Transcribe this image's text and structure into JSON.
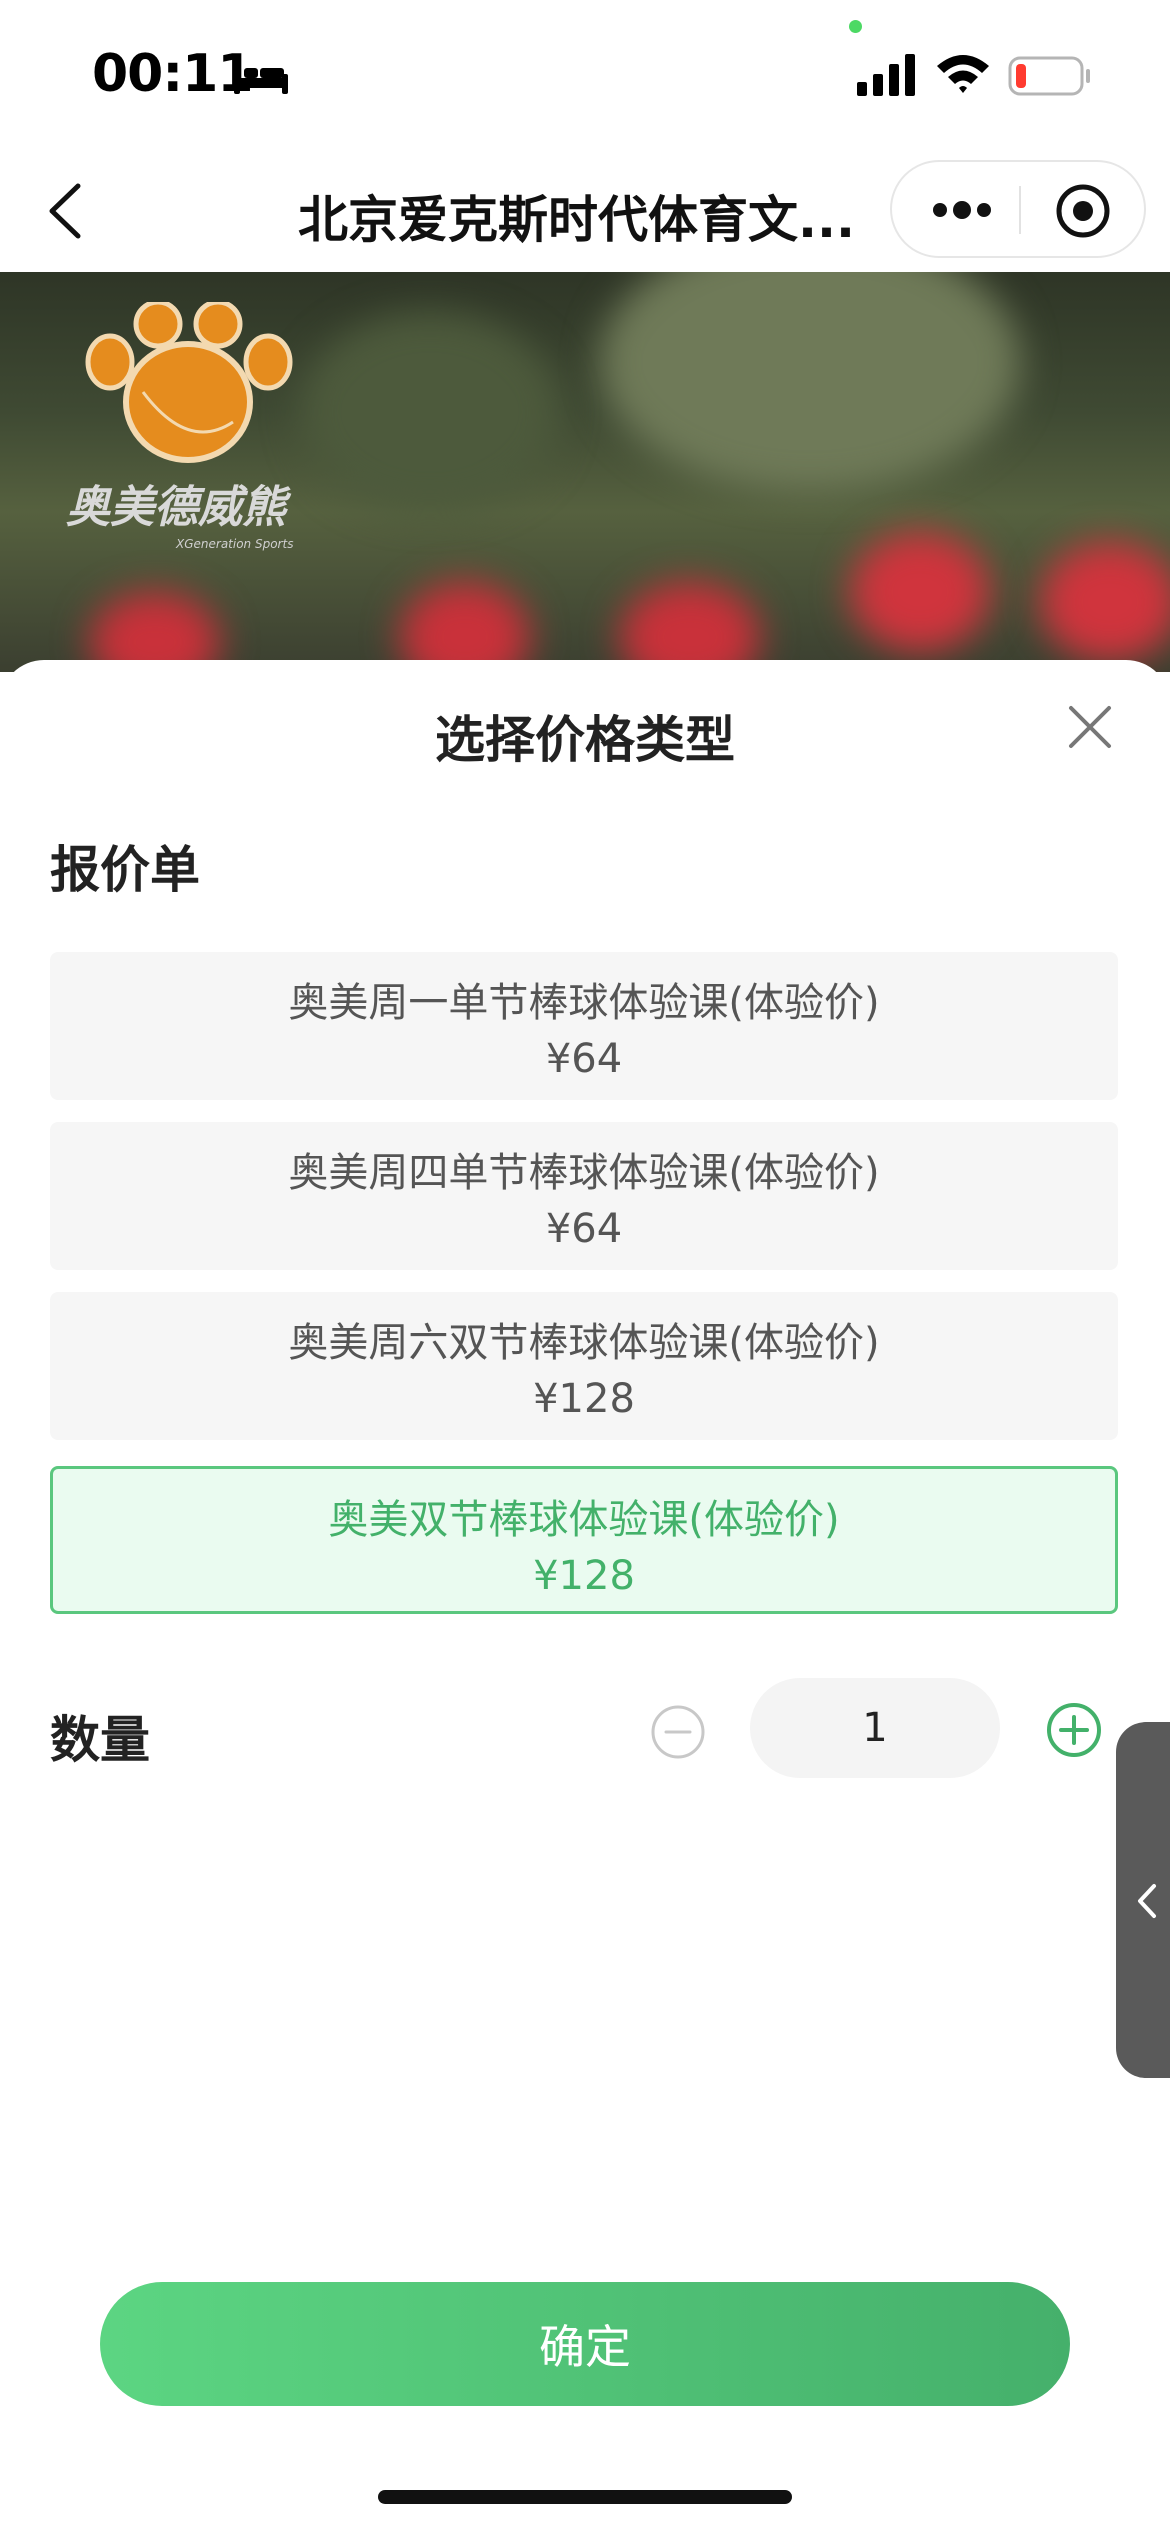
{
  "status_bar": {
    "time": "00:11",
    "icons": [
      "bed-icon",
      "cellular-signal-icon",
      "wifi-icon",
      "battery-low-icon"
    ],
    "battery_color": "#ff3b30"
  },
  "nav_bar": {
    "title": "北京爱克斯时代体育文...",
    "icons": [
      "back-icon",
      "more-icon",
      "target-icon"
    ]
  },
  "banner": {
    "logo_text": "奥美德威熊",
    "logo_subtext": "XGeneration Sports"
  },
  "sheet": {
    "title": "选择价格类型",
    "section_label": "报价单",
    "options": [
      {
        "name": "奥美周一单节棒球体验课(体验价)",
        "price": "¥64",
        "selected": false
      },
      {
        "name": "奥美周四单节棒球体验课(体验价)",
        "price": "¥64",
        "selected": false
      },
      {
        "name": "奥美周六双节棒球体验课(体验价)",
        "price": "¥128",
        "selected": false
      },
      {
        "name": "奥美双节棒球体验课(体验价)",
        "price": "¥128",
        "selected": true
      }
    ],
    "quantity_label": "数量",
    "quantity_value": "1",
    "confirm_label": "确定"
  },
  "colors": {
    "accent_green": "#43b16a",
    "selected_bg": "#eafbf0",
    "option_bg": "#f6f6f6"
  }
}
